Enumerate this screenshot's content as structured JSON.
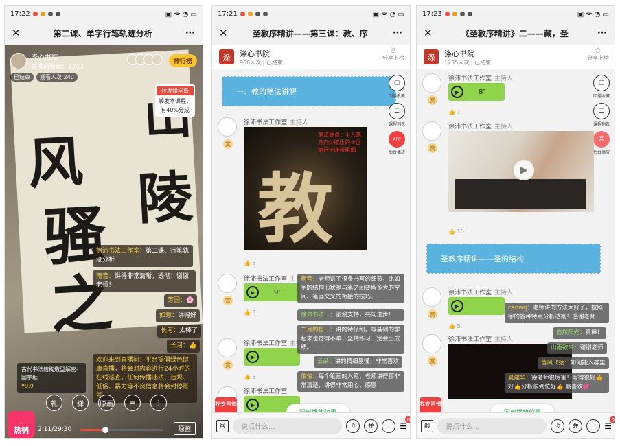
{
  "p1": {
    "time": "17:22",
    "title": "第二课、单字行笔轨迹分析",
    "host_name": "涤心书院",
    "host_fans": "直播间粉丝：1203",
    "ended": "已结束",
    "viewers": "观看人次 240",
    "rank_label": "排行榜",
    "promo_head": "转发赚学费",
    "promo_body": "转发本课程，有40%分成",
    "calligraphy1": "风",
    "calligraphy2": "骚",
    "calligraphy3": "之",
    "calligraphy4": "山",
    "calligraphy5": "陵",
    "chats": [
      {
        "name": "徐沛书法工作室：",
        "text": "第二课、行笔轨迹分析"
      },
      {
        "name": "雨音：",
        "text": "讲得非常清晰，透彻！谢谢老师！"
      },
      {
        "name": "芳园：",
        "text": "🌸"
      },
      {
        "name": "如意：",
        "text": "讲得好"
      },
      {
        "name": "长河：",
        "text": "太棒了"
      },
      {
        "name": "长河：",
        "text": "👍"
      }
    ],
    "notice": "欢迎来到直播间！平台提倡绿色健康直播，将会对内容进行24小时的在线巡查，任何传播违法、违规、低俗、暴力等不良信息将会封停账号",
    "book_text": "古代书法结构造型解密-国字框",
    "price": "¥9.9",
    "ctrl_labels": [
      "礼",
      "弹",
      "原画",
      "≡",
      "⋮"
    ],
    "hot": "热销",
    "progress_text": "2:11/29:30",
    "progress_value": 0.3,
    "orig_label": "原画"
  },
  "p2": {
    "time": "17:21",
    "title": "圣教序精讲——第三课：教、序",
    "org": "涤心书院",
    "stats": "968人次 | 已结束",
    "share": "分享上榜",
    "section1": "一、教的笔法讲解",
    "side": [
      "回播收藏",
      "课程列表",
      "后台播放"
    ],
    "host": "徐沛书法工作室",
    "host_tag": "主持人",
    "big_char": "教",
    "note": "笔法要点：①入笔方向②按压的③运笔行④连带粗细",
    "likes1": "5",
    "voice1": "9″",
    "likes2": "3",
    "likes3": "5",
    "danmu": [
      {
        "name": "雨音：",
        "text": "老师讲了很多书写的细节，比如字的结构形状笔与笔之间要留多大的空间、笔画交叉的衔接的技巧、..."
      },
      {
        "name": "徐沛书法…：",
        "text": "谢谢支持，共同进步！"
      },
      {
        "name": "二月的鱼…：",
        "text": "讲的特仔细，零基础的学起来也觉得不难，坚持练习一定会出成绩。"
      },
      {
        "name": "云朵：",
        "text": "讲的精细易懂，非常喜欢"
      },
      {
        "name": "佑佑：",
        "text": "每个笔画的入笔，老师讲得都非常清楚，讲得非常用心，感恩"
      }
    ],
    "backpos": "回到播放位置",
    "live": "我要直播",
    "input": "说点什么...",
    "homework": "作业"
  },
  "p3": {
    "time": "17:23",
    "title": "《圣教序精讲》二——藏，圣",
    "org": "涤心书院",
    "stats": "1235人次 | 已结束",
    "share": "分享上榜",
    "side": [
      "回播收藏",
      "课程列表",
      "后台播放"
    ],
    "host": "徐沛书法工作室",
    "host_tag": "主持人",
    "voice1": "8″",
    "likes1": "7",
    "likes2": "10",
    "section2": "圣教序精讲——圣的结构",
    "likes3": "5",
    "danmu": [
      {
        "name": "caowq：",
        "text": "老师讲的方法太好了，按照字的各种特点分析透彻！感谢老师"
      },
      {
        "name": "自然阳光：",
        "text": "真棒！"
      },
      {
        "name": "山雨欲来：",
        "text": "谢谢老师"
      },
      {
        "name": "苗风飞扬：",
        "text": "如何能入群里"
      },
      {
        "name": "夏建华：",
        "text": "徐老师很厉害！写得很好👍 好👍分析很到位好👍 最喜欢💕"
      }
    ],
    "backpos": "回到播放位置",
    "live": "我要直播",
    "input": "说点什么...",
    "homework": "作业"
  }
}
